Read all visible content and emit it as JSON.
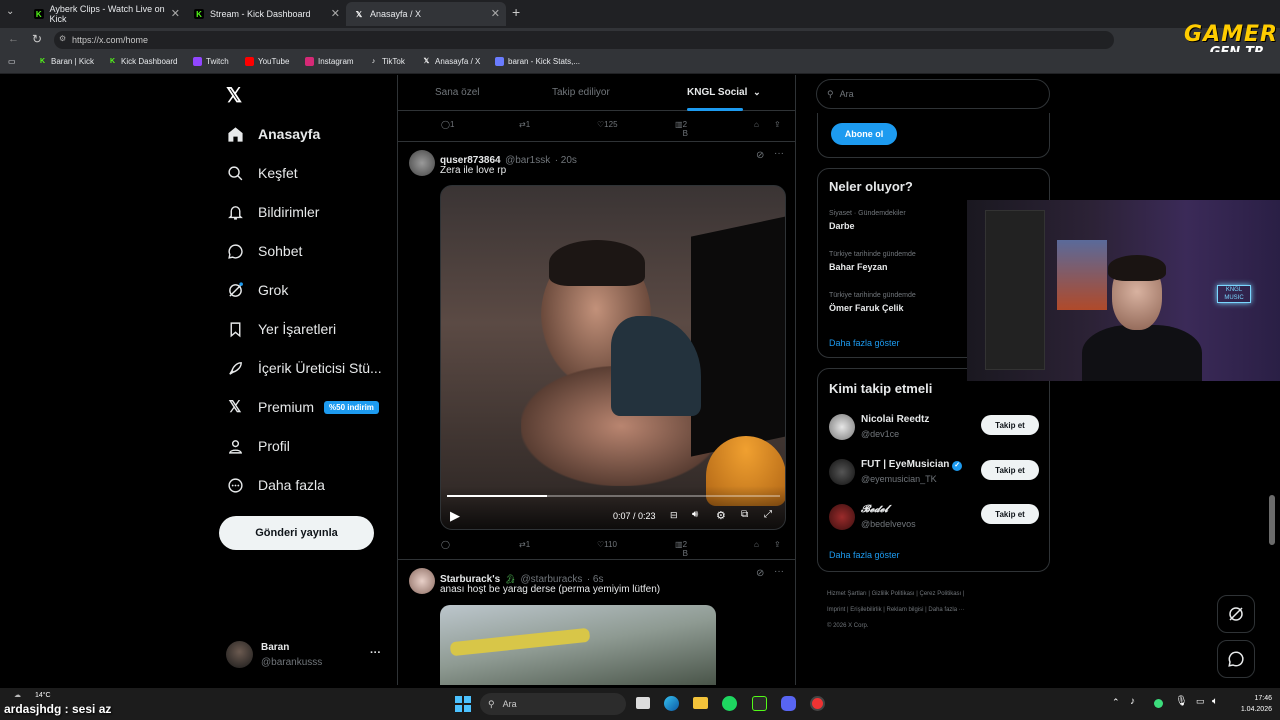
{
  "browser": {
    "tabs": [
      {
        "label": "Ayberk Clips - Watch Live on Kick",
        "icon": "kick-icon",
        "active": false
      },
      {
        "label": "Stream - Kick Dashboard",
        "icon": "kick-icon",
        "active": false
      },
      {
        "label": "Anasayfa / X",
        "icon": "x-icon",
        "active": true
      }
    ],
    "url": "https://x.com/home",
    "bookmarks": [
      "Baran | Kick",
      "Kick Dashboard",
      "Twitch",
      "YouTube",
      "Instagram",
      "TikTok",
      "Anasayfa / X",
      "baran - Kick Stats,..."
    ]
  },
  "watermark": {
    "line1": "GAMER",
    "line2": "GEN.TR"
  },
  "sidebar": {
    "items": [
      {
        "label": "Anasayfa",
        "icon": "home-icon"
      },
      {
        "label": "Keşfet",
        "icon": "search-icon"
      },
      {
        "label": "Bildirimler",
        "icon": "bell-icon"
      },
      {
        "label": "Sohbet",
        "icon": "chat-icon"
      },
      {
        "label": "Grok",
        "icon": "grok-icon"
      },
      {
        "label": "Yer İşaretleri",
        "icon": "bookmark-icon"
      },
      {
        "label": "İçerik Üreticisi Stü...",
        "icon": "rocket-icon"
      },
      {
        "label": "Premium",
        "icon": "x-icon"
      },
      {
        "label": "Profil",
        "icon": "person-icon"
      },
      {
        "label": "Daha fazla",
        "icon": "more-circle-icon"
      }
    ],
    "premium_badge": "%50 indirim",
    "post_button": "Gönderi yayınla",
    "account": {
      "name": "Baran",
      "handle": "@barankusss",
      "more": "···"
    }
  },
  "feed": {
    "tabs": [
      "Sana özel",
      "Takip ediliyor",
      "KNGL Social"
    ],
    "top_actions": {
      "replies": "1",
      "reposts": "1",
      "likes": "125",
      "views": "2 B"
    },
    "tweet1": {
      "name": "quser873864",
      "handle": "@bar1ssk",
      "time": "· 20s",
      "text": "Zera ile love rp",
      "video_time": "0:07 / 0:23",
      "progress": 0.3,
      "actions": {
        "reposts": "1",
        "likes": "110",
        "views": "2 B"
      }
    },
    "tweet2": {
      "name": "Starburack's",
      "handle": "@starburacks",
      "time": "· 6s",
      "text": "anası hoşt be yarag derse (perma yemiyim lütfen)"
    }
  },
  "right": {
    "search_placeholder": "Ara",
    "subscribe": "Abone ol",
    "trends_title": "Neler oluyor?",
    "trends": [
      {
        "context": "Siyaset · Gündemdekiler",
        "name": "Darbe"
      },
      {
        "context": "Türkiye tarihinde gündemde",
        "name": "Bahar Feyzan"
      },
      {
        "context": "Türkiye tarihinde gündemde",
        "name": "Ömer Faruk Çelik"
      }
    ],
    "show_more": "Daha fazla göster",
    "who_title": "Kimi takip etmeli",
    "who": [
      {
        "name": "Nicolai Reedtz",
        "handle": "@dev1ce",
        "button": "Takip et"
      },
      {
        "name": "FUT | EyeMusician",
        "handle": "@eyemusician_TK",
        "button": "Takip et"
      },
      {
        "name": "𝓑𝓮𝓭𝓮𝓵",
        "handle": "@bedelvevos",
        "button": "Takip et"
      }
    ],
    "who_more": "Daha fazla göster",
    "footer": [
      "Hizmet Şartları",
      "Gizlilik Politikası",
      "Çerez Politikası",
      "Imprint",
      "Erişilebilirlik",
      "Reklam bilgisi",
      "Daha fazla ···",
      "© 2026 X Corp."
    ]
  },
  "overlay": {
    "chat_line": "ardasjhdg : sesi az"
  },
  "taskbar": {
    "weather": "14°C",
    "search": "Ara",
    "time": "17:46",
    "date": "1.04.2026"
  },
  "colors": {
    "accent": "#1d9bf0",
    "kick": "#53fc18",
    "bg": "#000000"
  }
}
